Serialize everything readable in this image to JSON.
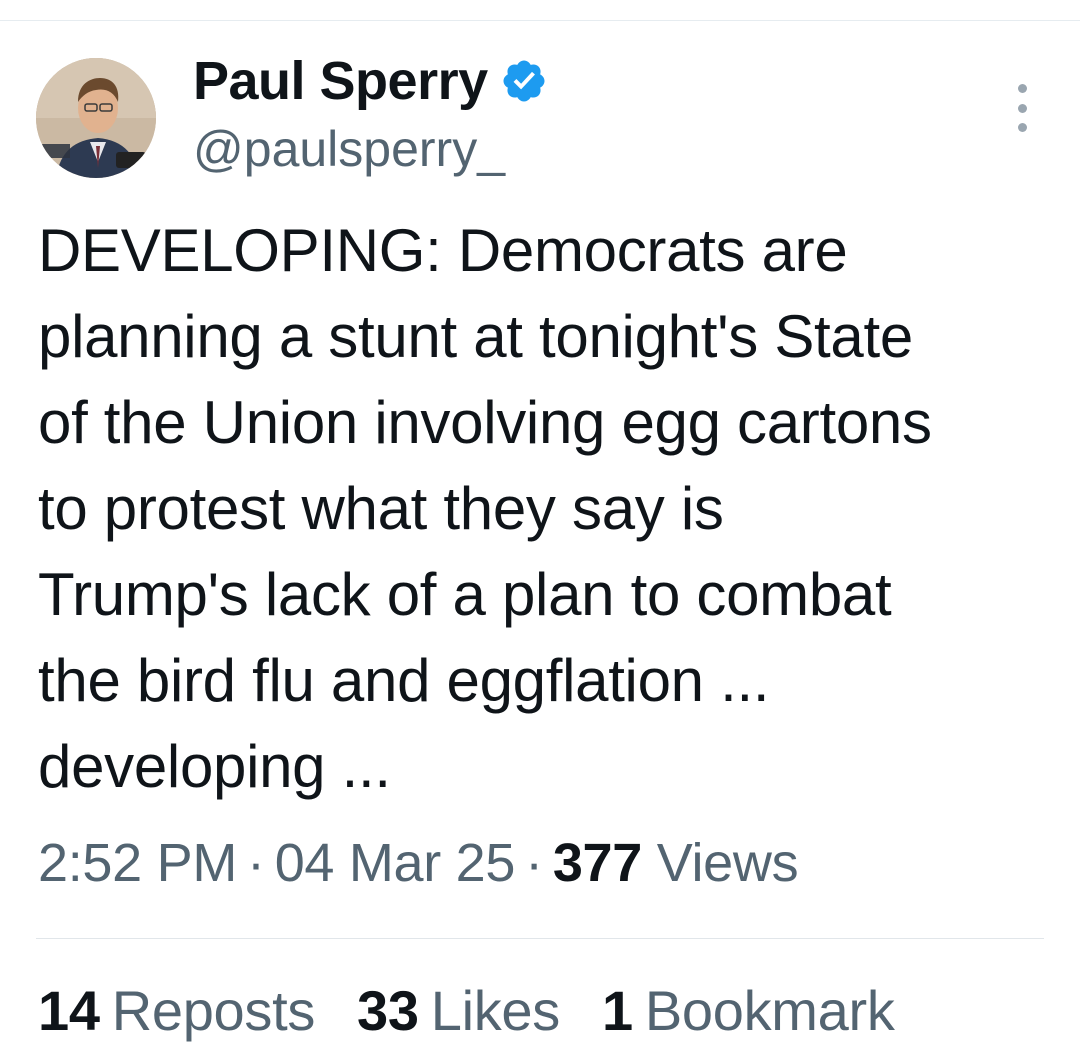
{
  "author": {
    "display_name": "Paul Sperry",
    "handle": "@paulsperry_",
    "verified": true,
    "verified_color": "#1d9bf0"
  },
  "tweet": {
    "text": "DEVELOPING: Democrats are\nplanning a stunt at tonight's State\nof the Union involving egg cartons\nto protest what they say is\nTrump's lack of a plan to combat\nthe bird flu and eggflation ...\ndeveloping ..."
  },
  "meta": {
    "time": "2:52 PM",
    "separator": "·",
    "date": "04 Mar 25",
    "views_count": "377",
    "views_label": "Views"
  },
  "stats": {
    "reposts": {
      "count": "14",
      "label": "Reposts"
    },
    "likes": {
      "count": "33",
      "label": "Likes"
    },
    "bookmarks": {
      "count": "1",
      "label": "Bookmark"
    }
  },
  "icons": {
    "more": "more-vertical-icon",
    "verified": "verified-badge-icon"
  },
  "colors": {
    "text": "#0f1419",
    "secondary": "#536471",
    "divider": "#e6ecf0"
  }
}
